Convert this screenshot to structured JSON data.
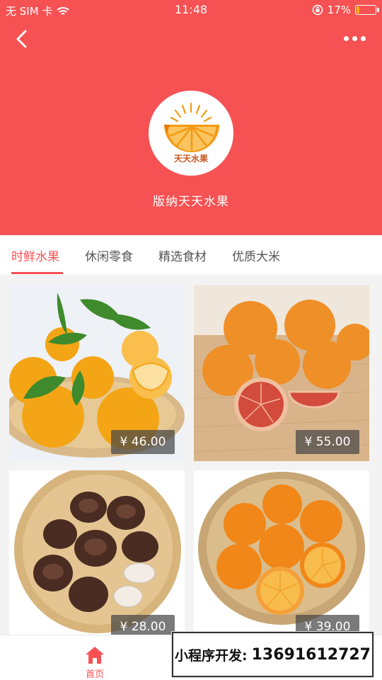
{
  "status_bar": {
    "carrier": "无 SIM 卡",
    "time": "11:48",
    "battery_text": "17%",
    "battery_level": 0.17
  },
  "header": {
    "shop_name": "版纳天天水果",
    "logo_text": "天天水果",
    "background_color": "#f65253"
  },
  "tabs": [
    {
      "label": "时鲜水果",
      "active": true
    },
    {
      "label": "休闲零食",
      "active": false
    },
    {
      "label": "精选食材",
      "active": false
    },
    {
      "label": "优质大米",
      "active": false
    }
  ],
  "products": [
    {
      "price": "¥ 46.00"
    },
    {
      "price": "¥ 55.00"
    },
    {
      "price": "¥ 28.00"
    },
    {
      "price": "¥ 39.00"
    }
  ],
  "bottom_nav": {
    "home_label": "首页"
  },
  "banner": {
    "prefix": "小程序开发:",
    "phone": "13691612727"
  },
  "accent_color": "#f65253"
}
